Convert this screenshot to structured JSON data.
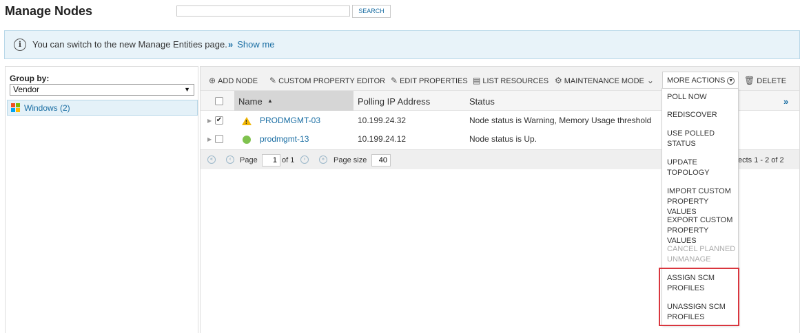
{
  "header": {
    "title": "Manage Nodes",
    "search_placeholder": "",
    "search_button": "SEARCH"
  },
  "banner": {
    "text": "You can switch to the new Manage Entities page.",
    "link_chevron": "»",
    "link_text": "Show me"
  },
  "left_panel": {
    "group_by_label": "Group by:",
    "group_by_value": "Vendor",
    "groups": [
      {
        "label": "Windows (2)"
      }
    ]
  },
  "toolbar": {
    "add_node": "ADD NODE",
    "custom_property_editor": "CUSTOM PROPERTY EDITOR",
    "edit_properties": "EDIT PROPERTIES",
    "list_resources": "LIST RESOURCES",
    "maintenance_mode": "MAINTENANCE MODE",
    "more_actions": "MORE ACTIONS",
    "delete": "DELETE"
  },
  "grid": {
    "columns": {
      "name": "Name",
      "sort_indicator": "▲",
      "polling_ip": "Polling IP Address",
      "status": "Status"
    },
    "rows": [
      {
        "checked": true,
        "status_icon": "warning-icon",
        "name": "PRODMGMT-03",
        "ip": "10.199.24.32",
        "status": "Node status is Warning, Memory Usage threshold"
      },
      {
        "checked": false,
        "status_icon": "up-status-icon",
        "name": "prodmgmt-13",
        "ip": "10.199.24.12",
        "status": "Node status is Up."
      }
    ]
  },
  "pager": {
    "page_label": "Page",
    "page_value": "1",
    "of_label": "of 1",
    "page_size_label": "Page size",
    "page_size_value": "40",
    "summary": "ects 1 - 2 of 2"
  },
  "more_actions_menu": {
    "poll_now": "POLL NOW",
    "rediscover": "REDISCOVER",
    "use_polled_status_1": "USE POLLED",
    "use_polled_status_2": "STATUS",
    "update_topology_1": "UPDATE",
    "update_topology_2": "TOPOLOGY",
    "import_custom_1": "IMPORT CUSTOM",
    "import_custom_2": "PROPERTY VALUES",
    "export_custom_1": "EXPORT CUSTOM",
    "export_custom_2": "PROPERTY VALUES",
    "cancel_planned_1": "CANCEL PLANNED",
    "cancel_planned_2": "UNMANAGE",
    "assign_scm_1": "ASSIGN SCM",
    "assign_scm_2": "PROFILES",
    "unassign_scm_1": "UNASSIGN SCM",
    "unassign_scm_2": "PROFILES"
  },
  "colors": {
    "link": "#1a6ea3",
    "highlight": "#d9363e",
    "warning": "#f2b705",
    "up": "#7fc24e",
    "windows_red": "#f25022",
    "windows_green": "#7fba00",
    "windows_blue": "#00a4ef",
    "windows_yellow": "#ffb900"
  }
}
